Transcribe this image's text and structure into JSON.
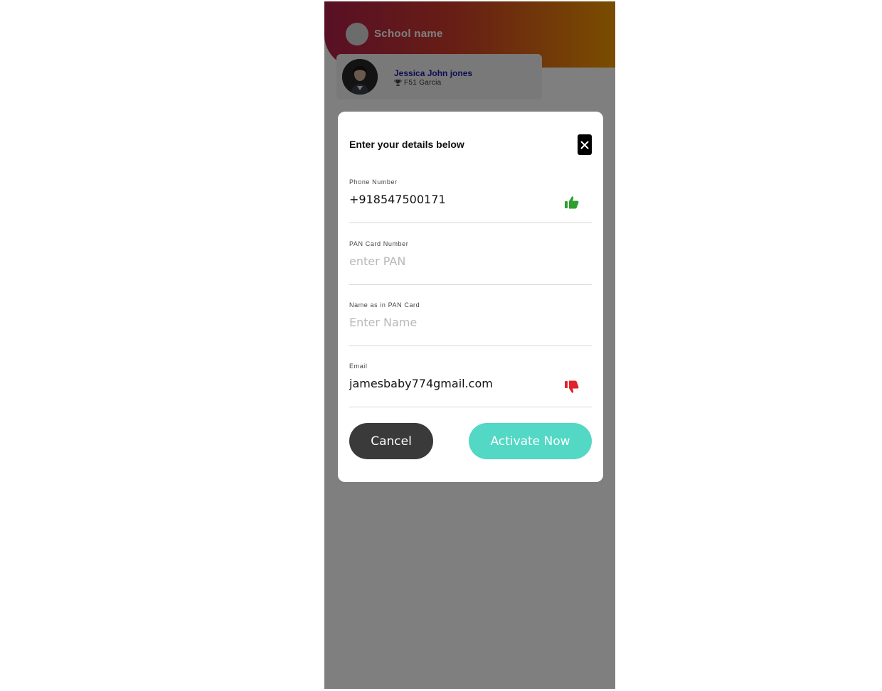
{
  "header": {
    "school_name": "School name"
  },
  "profile": {
    "name": "Jessica John jones",
    "class_info": "F51 Garcia"
  },
  "modal": {
    "title": "Enter your details below",
    "close_icon": "close-icon",
    "fields": [
      {
        "label": "Phone Number",
        "value": "+918547500171",
        "placeholder": "",
        "status_icon": "thumbs-up-icon",
        "status_color": "#2e9e2e"
      },
      {
        "label": "PAN Card Number",
        "value": "",
        "placeholder": "enter PAN"
      },
      {
        "label": "Name as in PAN Card",
        "value": "",
        "placeholder": "Enter Name"
      },
      {
        "label": "Email",
        "value": "jamesbaby774gmail.com",
        "placeholder": "",
        "status_icon": "thumbs-down-icon",
        "status_color": "#e0242b"
      }
    ],
    "cancel_label": "Cancel",
    "activate_label": "Activate Now"
  },
  "colors": {
    "header_gradient": [
      "#b0204a",
      "#f49a00"
    ],
    "activate_button": "#52d8c4",
    "cancel_button": "#3a3a3a",
    "student_name": "#1a1aa8"
  }
}
